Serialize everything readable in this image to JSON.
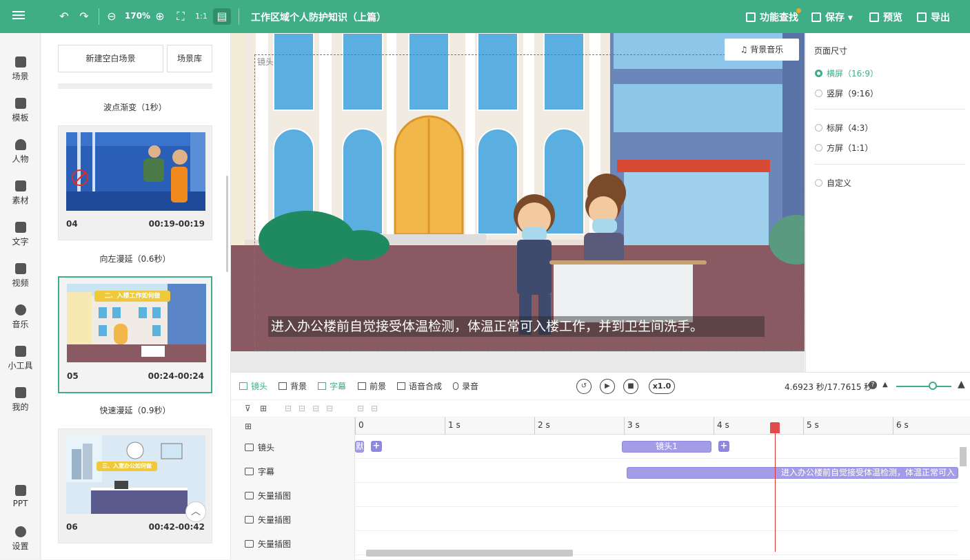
{
  "toolbar": {
    "zoom": "170%",
    "title": "工作区域个人防护知识（上篇）",
    "find_label": "功能查找",
    "save_label": "保存",
    "preview_label": "预览",
    "export_label": "导出"
  },
  "sidebar": {
    "items": [
      {
        "label": "场景",
        "icon": "scene-icon"
      },
      {
        "label": "模板",
        "icon": "template-icon"
      },
      {
        "label": "人物",
        "icon": "person-icon"
      },
      {
        "label": "素材",
        "icon": "material-icon"
      },
      {
        "label": "文字",
        "icon": "text-icon"
      },
      {
        "label": "视频",
        "icon": "video-icon"
      },
      {
        "label": "音乐",
        "icon": "music-icon"
      },
      {
        "label": "小工具",
        "icon": "toolbox-icon"
      },
      {
        "label": "我的",
        "icon": "my-icon"
      },
      {
        "label": "PPT",
        "icon": "ppt-icon"
      },
      {
        "label": "设置",
        "icon": "settings-icon"
      }
    ]
  },
  "scenes": {
    "new_blank": "新建空白场景",
    "library": "场景库",
    "transitions": [
      "波点渐变（1秒）",
      "向左漫延（0.6秒）",
      "快速漫延（0.9秒）"
    ],
    "cards": [
      {
        "num": "04",
        "time": "00:19-00:19"
      },
      {
        "num": "05",
        "time": "00:24-00:24",
        "banner": "二、入楼工作如何做"
      },
      {
        "num": "06",
        "time": "00:42-00:42",
        "banner": "三、入室办公如何做"
      }
    ]
  },
  "canvas": {
    "lens_label": "镜头",
    "bgm_label": "背景音乐",
    "subtitle": "进入办公楼前自觉接受体温检测，体温正常可入楼工作，并到卫生间洗手。"
  },
  "props": {
    "heading": "页面尺寸",
    "options": [
      "横屏（16:9）",
      "竖屏（9:16）",
      "标屏（4:3）",
      "方屏（1:1）",
      "自定义"
    ],
    "selected": "横屏（16:9）"
  },
  "timeline": {
    "tabs": [
      "镜头",
      "背景",
      "字幕",
      "前景",
      "语音合成",
      "录音"
    ],
    "active_tab": "字幕",
    "speed": "x1.0",
    "time": "4.6923 秒/17.7615 秒",
    "ticks": [
      "0",
      "1 s",
      "2 s",
      "3 s",
      "4 s",
      "5 s",
      "6 s"
    ],
    "tracks": [
      "镜头",
      "字幕",
      "矢量插图",
      "矢量插图",
      "矢量插图"
    ],
    "clip_default": "默",
    "clip_lens": "镜头1",
    "clip_subtitle": "进入办公楼前自觉接受体温检测，体温正常可入"
  }
}
